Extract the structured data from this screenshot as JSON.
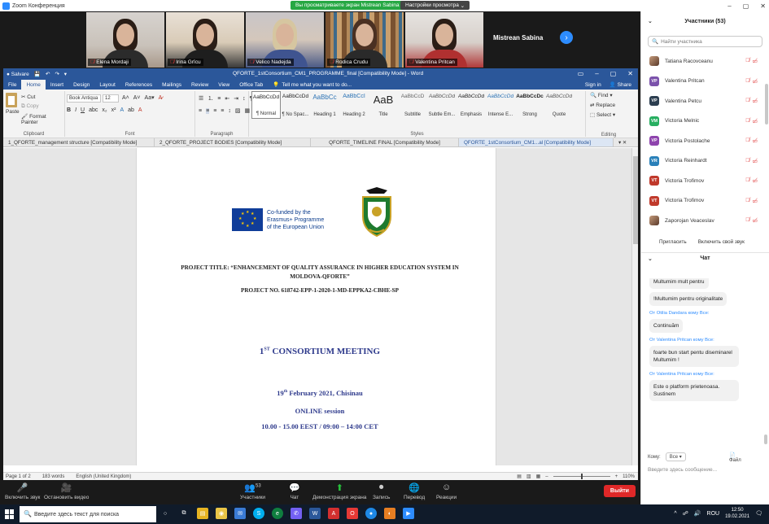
{
  "zoom": {
    "window_title": "Zoom Конференция",
    "share_banner": "Вы просматриваете экран Mistrean Sabina",
    "view_options": "Настройки просмотра",
    "presenter_name": "Mistrean Sabina",
    "gallery": [
      {
        "name": "Elena Mordaji"
      },
      {
        "name": "Irina Grîcu"
      },
      {
        "name": "Velico Nadejda"
      },
      {
        "name": "Rodica Crudu"
      },
      {
        "name": "Valentina Pritcan"
      }
    ],
    "toolbar": {
      "mute": "Включить звук",
      "video": "Остановить видео",
      "participants": "Участники",
      "participants_count": "53",
      "chat": "Чат",
      "share": "Демонстрация экрана",
      "record": "Запись",
      "translate": "Перевод",
      "reactions": "Реакции",
      "leave": "Выйти"
    },
    "panel": {
      "participants_title": "Участники (53)",
      "search_placeholder": "Найти участника",
      "participants": [
        {
          "name": "Tatiana Racovceanu",
          "initials": "",
          "color": ""
        },
        {
          "name": "Valentina Pritcan",
          "initials": "VP",
          "color": "#7b52ab"
        },
        {
          "name": "Valentina Petcu",
          "initials": "VP",
          "color": "#2c3e50"
        },
        {
          "name": "Victoria Melnic",
          "initials": "VM",
          "color": "#27ae60"
        },
        {
          "name": "Victoria Postolache",
          "initials": "VP",
          "color": "#8e44ad"
        },
        {
          "name": "Victoria Reinhardt",
          "initials": "VR",
          "color": "#2980b9"
        },
        {
          "name": "Victoria Trofimov",
          "initials": "VT",
          "color": "#c0392b"
        },
        {
          "name": "Victoria Trofimov",
          "initials": "VT",
          "color": "#c0392b"
        },
        {
          "name": "Zaporojan Veaceslav",
          "initials": "",
          "color": ""
        }
      ],
      "invite": "Пригласить",
      "unmute_me": "Включить свой звук",
      "chat_title": "Чат",
      "chat_messages": [
        {
          "from": "",
          "text": "Multumim mult pentru"
        },
        {
          "from": "",
          "text": "!Multumim pentru originalitate"
        },
        {
          "from": "От Otilia Dandara кому Все:",
          "text": "Continuăm"
        },
        {
          "from": "От Valentina Pritcan кому Все:",
          "text": "foarte bun start pentu diseminarel Multumim !"
        },
        {
          "from": "От Valentina Pritcan кому Все:",
          "text": "Este o platform prietenoasa. Sustinem"
        }
      ],
      "chat_to_label": "Кому:",
      "chat_to_value": "Все",
      "file_label": "Файл",
      "chat_placeholder": "Введите здесь сообщение..."
    }
  },
  "word": {
    "autosave": "Salvare",
    "title": "QFORTE_1stConsortium_CM1_PROGRAMME_final [Compatibility Mode] - Word",
    "signin": "Sign in",
    "share": "Share",
    "tabs": [
      "File",
      "Home",
      "Insert",
      "Design",
      "Layout",
      "References",
      "Mailings",
      "Review",
      "View",
      "Office Tab"
    ],
    "tell_me": "Tell me what you want to do...",
    "clipboard": {
      "paste": "Paste",
      "cut": "Cut",
      "copy": "Copy",
      "format_painter": "Format Painter",
      "label": "Clipboard"
    },
    "font": {
      "name": "Book Antiqua",
      "size": "12",
      "label": "Font"
    },
    "paragraph_label": "Paragraph",
    "styles_label": "Styles",
    "styles": [
      {
        "preview": "AaBbCcDd",
        "name": "¶ Normal"
      },
      {
        "preview": "AaBbCcDd",
        "name": "¶ No Spac..."
      },
      {
        "preview": "AaBbCc",
        "name": "Heading 1"
      },
      {
        "preview": "AaBbCcI",
        "name": "Heading 2"
      },
      {
        "preview": "AaB",
        "name": "Title"
      },
      {
        "preview": "AaBbCcD",
        "name": "Subtitle"
      },
      {
        "preview": "AaBbCcDd",
        "name": "Subtle Em..."
      },
      {
        "preview": "AaBbCcDd",
        "name": "Emphasis"
      },
      {
        "preview": "AaBbCcDd",
        "name": "Intense E..."
      },
      {
        "preview": "AaBbCcDc",
        "name": "Strong"
      },
      {
        "preview": "AaBbCcDd",
        "name": "Quote"
      }
    ],
    "editing": {
      "find": "Find",
      "replace": "Replace",
      "select": "Select",
      "label": "Editing"
    },
    "doc_tabs": [
      "1_QFORTE_management structure [Compatibility Mode]",
      "2_QFORTE_PROJECT BODIES [Compatibility Mode]",
      "QFORTE_TIMELINE FINAL [Compatibility Mode]",
      "QFORTE_1stConsortium_CM1...al [Compatibility Mode]"
    ],
    "doc": {
      "eu_line1": "Co-funded by the",
      "eu_line2": "Erasmus+ Programme",
      "eu_line3": "of the European Union",
      "project_title": "PROJECT TITLE: “ENHANCEMENT OF QUALITY ASSURANCE IN HIGHER EDUCATION SYSTEM IN MOLDOVA-QFORTE”",
      "project_no": "PROJECT NO. 618742-EPP-1-2020-1-MD-EPPKA2-CBHE-SP",
      "meeting_num": "1",
      "meeting_sup": "ST",
      "meeting_title": " CONSORTIUM MEETING",
      "date_day": "19",
      "date_sup": "th",
      "date_rest": " February 2021, Chisinau",
      "session": "ONLINE session",
      "time": "10.00 - 15.00 EEST / 09:00 – 14:00 CET"
    },
    "status": {
      "page": "Page 1 of 2",
      "words": "183 words",
      "lang": "English (United Kingdom)",
      "zoom": "110%"
    }
  },
  "taskbar": {
    "search_placeholder": "Введите здесь текст для поиска",
    "lang": "ROU",
    "time": "12:50",
    "date": "19.02.2021"
  }
}
